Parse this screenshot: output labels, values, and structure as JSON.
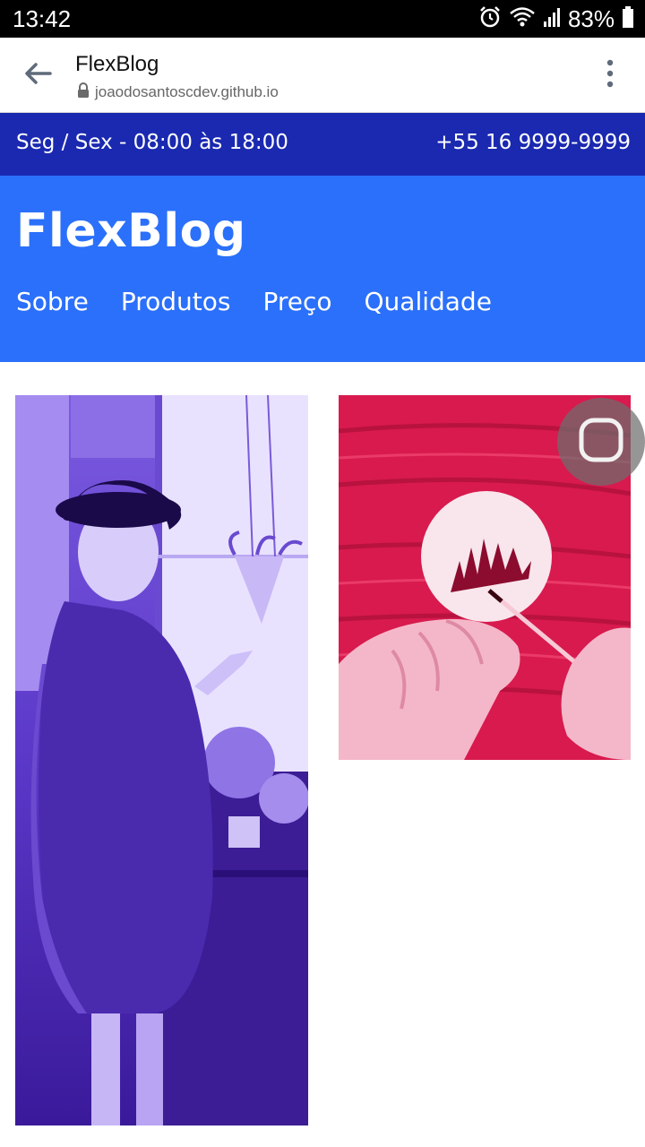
{
  "status_bar": {
    "time": "13:42",
    "battery": "83%",
    "icons": [
      "alarm-icon",
      "wifi-icon",
      "signal-icon",
      "battery-icon"
    ]
  },
  "browser": {
    "page_title": "FlexBlog",
    "url": "joaodosantoscdev.github.io",
    "icons": [
      "back-arrow-icon",
      "lock-icon",
      "more-vert-icon"
    ]
  },
  "info_bar": {
    "hours": "Seg / Sex - 08:00 às 18:00",
    "phone": "+55 16 9999-9999"
  },
  "header": {
    "logo": "FlexBlog",
    "nav": [
      {
        "label": "Sobre"
      },
      {
        "label": "Produtos"
      },
      {
        "label": "Preço"
      },
      {
        "label": "Qualidade"
      }
    ]
  },
  "colors": {
    "info_bar_bg": "#1a29b0",
    "header_bg": "#2b70fa",
    "photo_left_tint": "#6a3fd6",
    "photo_right_tint": "#d61a52"
  },
  "floating_button": {
    "icon": "rounded-square-icon"
  }
}
